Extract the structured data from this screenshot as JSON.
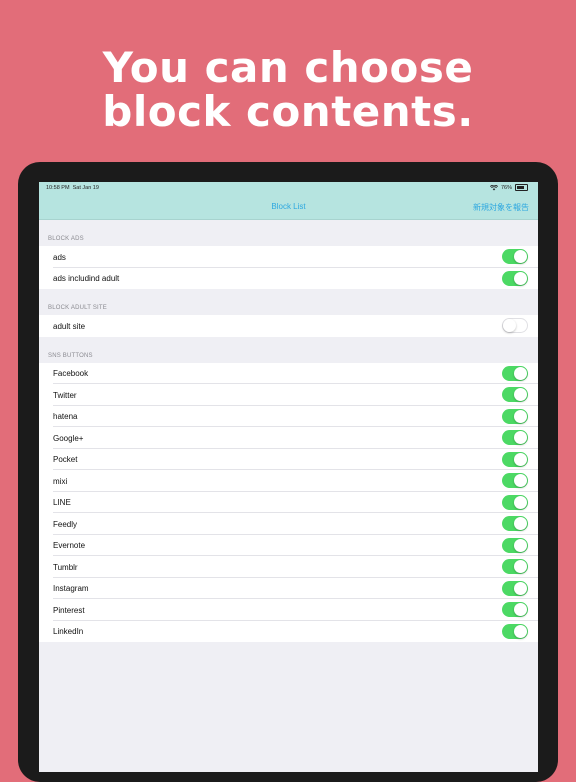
{
  "headline": {
    "line1": "You can choose",
    "line2": "block contents."
  },
  "statusbar": {
    "time": "10:58 PM",
    "date": "Sat Jan 19",
    "battery": "76%"
  },
  "navbar": {
    "title": "Block List",
    "action": "新規対象を報告"
  },
  "sections": {
    "ads": {
      "header": "BLOCK ADS",
      "rows": [
        {
          "label": "ads",
          "on": true
        },
        {
          "label": "ads includind adult",
          "on": true
        }
      ]
    },
    "adult": {
      "header": "BLOCK ADULT SITE",
      "rows": [
        {
          "label": "adult site",
          "on": false
        }
      ]
    },
    "sns": {
      "header": "SNS BUTTONS",
      "rows": [
        {
          "label": "Facebook",
          "on": true
        },
        {
          "label": "Twitter",
          "on": true
        },
        {
          "label": "hatena",
          "on": true
        },
        {
          "label": "Google+",
          "on": true
        },
        {
          "label": "Pocket",
          "on": true
        },
        {
          "label": "mixi",
          "on": true
        },
        {
          "label": "LINE",
          "on": true
        },
        {
          "label": "Feedly",
          "on": true
        },
        {
          "label": "Evernote",
          "on": true
        },
        {
          "label": "Tumblr",
          "on": true
        },
        {
          "label": "Instagram",
          "on": true
        },
        {
          "label": "Pinterest",
          "on": true
        },
        {
          "label": "LinkedIn",
          "on": true
        }
      ]
    }
  },
  "colors": {
    "background": "#e26d79",
    "navbar": "#b6e4e0",
    "accent": "#2ea8e0",
    "toggle_on": "#4cd964"
  }
}
